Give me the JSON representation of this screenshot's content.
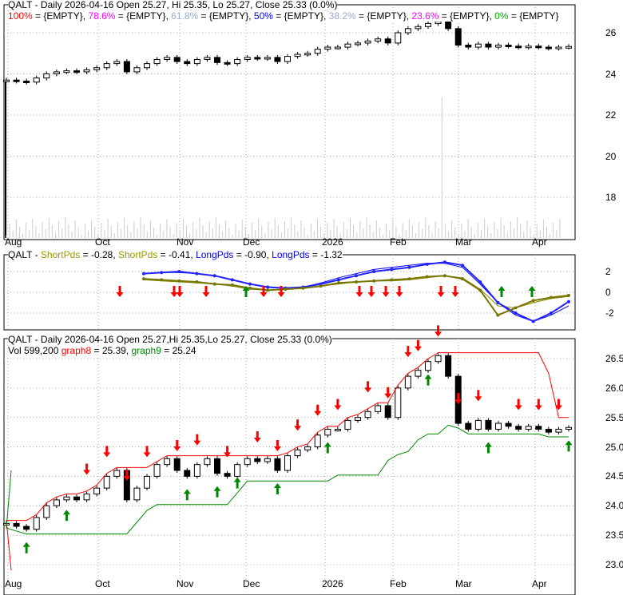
{
  "chart_data": [
    {
      "type": "candlestick",
      "title": "QALT - Daily 2026-04-16 Open 25.27, Hi 25.35, Lo 25.27, Close 25.33 (0.0%)",
      "fib_legend": [
        {
          "label": "100%",
          "value": "{EMPTY}",
          "color": "#ff0000"
        },
        {
          "label": "78.6%",
          "value": "{EMPTY}",
          "color": "#ff00ff"
        },
        {
          "label": "61.8%",
          "value": "{EMPTY}",
          "color": "#99aacc"
        },
        {
          "label": "50%",
          "value": "{EMPTY}",
          "color": "#0000ff"
        },
        {
          "label": "38.2%",
          "value": "{EMPTY}",
          "color": "#99aacc"
        },
        {
          "label": "23.6%",
          "value": "{EMPTY}",
          "color": "#ff00ff"
        },
        {
          "label": "0%",
          "value": "{EMPTY}",
          "color": "#00aa00"
        }
      ],
      "ylim": [
        16.5,
        27
      ],
      "yticks": [
        18,
        20,
        22,
        24,
        26
      ]
    },
    {
      "type": "line",
      "title_prefix": "QALT - ",
      "legend": [
        {
          "label": "ShortPds",
          "value": "-0.28",
          "color": "#999900"
        },
        {
          "label": "ShortPds",
          "value": "-0.41",
          "color": "#999900"
        },
        {
          "label": "LongPds",
          "value": "-0.90",
          "color": "#0000ff"
        },
        {
          "label": "LongPds",
          "value": "-1.32",
          "color": "#0000ff"
        }
      ],
      "ylim": [
        -3.2,
        3
      ],
      "yticks": [
        2,
        0,
        -2
      ],
      "short_fast": [
        1.3,
        1.2,
        1.1,
        1.0,
        0.8,
        0.7,
        0.4,
        0.2,
        0.3,
        0.4,
        0.6,
        0.9,
        1.0,
        1.1,
        1.2,
        1.3,
        1.5,
        1.6,
        1.3,
        0.2,
        -2.2,
        -1.5,
        -0.8,
        -0.5,
        -0.3
      ],
      "short_slow": [
        1.2,
        1.1,
        1.0,
        0.9,
        0.8,
        0.6,
        0.3,
        0.2,
        0.3,
        0.4,
        0.6,
        0.8,
        1.0,
        1.1,
        1.1,
        1.2,
        1.4,
        1.6,
        1.4,
        0.3,
        -1.3,
        -1.5,
        -1.0,
        -0.6,
        -0.4
      ],
      "long_fast": [
        1.8,
        1.9,
        2.0,
        1.8,
        1.6,
        1.2,
        0.8,
        0.5,
        0.4,
        0.5,
        0.8,
        1.2,
        1.6,
        2.0,
        2.2,
        2.4,
        2.7,
        2.9,
        2.6,
        1.0,
        -1.0,
        -2.0,
        -2.8,
        -2.0,
        -0.9
      ],
      "long_slow": [
        1.8,
        1.9,
        1.9,
        1.8,
        1.6,
        1.2,
        0.8,
        0.5,
        0.4,
        0.5,
        0.9,
        1.4,
        1.8,
        2.2,
        2.4,
        2.6,
        2.8,
        2.8,
        2.4,
        0.8,
        -1.0,
        -2.2,
        -2.8,
        -2.2,
        -1.3
      ]
    },
    {
      "type": "candlestick",
      "title": "QALT - Daily 2026-04-16 Open 25.27,Hi 25.35,Lo 25.27, Close 25.33 (0.0%)",
      "legend": [
        {
          "label": "Vol 599,200",
          "color": "#000000"
        },
        {
          "label": "graph8",
          "value": "25.39",
          "color": "#ff0000"
        },
        {
          "label": "graph9",
          "value": "25.24",
          "color": "#008800"
        }
      ],
      "ylim": [
        22.8,
        26.8
      ],
      "yticks": [
        "26.5",
        "26.0",
        "25.5",
        "25.0",
        "24.5",
        "24.0",
        "23.5",
        "23.0"
      ]
    },
    {
      "xticks": [
        "Aug",
        "Oct",
        "Nov",
        "Dec",
        "2026",
        "Feb",
        "Mar",
        "Apr"
      ]
    }
  ],
  "closes": [
    23.7,
    23.65,
    23.6,
    23.8,
    24.0,
    24.1,
    24.15,
    24.1,
    24.2,
    24.3,
    24.5,
    24.6,
    24.1,
    24.3,
    24.5,
    24.7,
    24.8,
    24.6,
    24.5,
    24.7,
    24.8,
    24.55,
    24.5,
    24.7,
    24.8,
    24.75,
    24.8,
    24.6,
    24.85,
    24.95,
    25.0,
    25.2,
    25.3,
    25.3,
    25.45,
    25.5,
    25.6,
    25.7,
    25.5,
    26.0,
    26.2,
    26.3,
    26.45,
    26.55,
    26.2,
    25.4,
    25.3,
    25.45,
    25.3,
    25.4,
    25.35,
    25.3,
    25.35,
    25.3,
    25.25,
    25.3,
    25.33
  ],
  "sell_idx": [
    8,
    10,
    12,
    14,
    17,
    19,
    22,
    25,
    27,
    29,
    31,
    33,
    36,
    38,
    40,
    41,
    43,
    45,
    47,
    51,
    53,
    55
  ],
  "buy_idx": [
    2,
    6,
    18,
    21,
    23,
    27,
    32,
    42,
    48,
    56
  ]
}
